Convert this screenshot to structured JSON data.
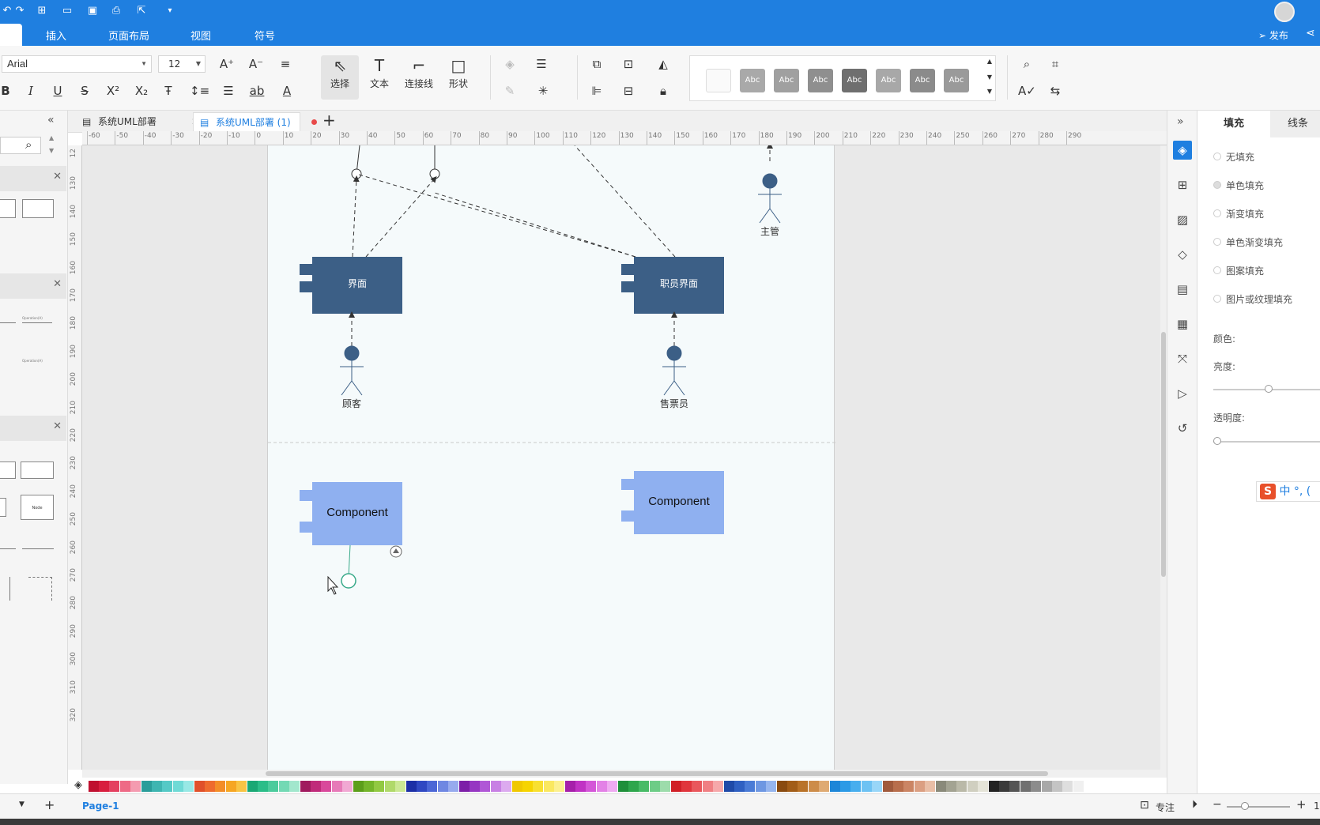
{
  "menu": {
    "items": [
      "插入",
      "页面布局",
      "视图",
      "符号"
    ],
    "publish": "发布"
  },
  "toolbar": {
    "font": "Arial",
    "size": "12",
    "tools": [
      "选择",
      "文本",
      "连接线",
      "形状"
    ],
    "style_sample": "Abc"
  },
  "tabs": [
    {
      "label": "系统UML部署"
    },
    {
      "label": "系统UML部署 (1)"
    }
  ],
  "ruler": {
    "h_ticks": [
      "-60",
      "-50",
      "-40",
      "-30",
      "-20",
      "-10",
      "0",
      "10",
      "20",
      "30",
      "40",
      "50",
      "60",
      "70",
      "80",
      "90",
      "100",
      "110",
      "120",
      "130",
      "140",
      "150",
      "160",
      "170",
      "180",
      "190",
      "200",
      "210",
      "220",
      "230",
      "240",
      "250",
      "260",
      "270",
      "280",
      "290"
    ],
    "v_ticks": [
      "12",
      "130",
      "140",
      "150",
      "160",
      "170",
      "180",
      "190",
      "200",
      "210",
      "220",
      "230",
      "240",
      "250",
      "260",
      "270",
      "280",
      "290",
      "300",
      "310",
      "320"
    ]
  },
  "diagram": {
    "components": [
      "界面",
      "职员界面",
      "Component",
      "Component"
    ],
    "actors": [
      "主管",
      "顾客",
      "售票员"
    ]
  },
  "right_panel": {
    "tabs": [
      "填充",
      "线条"
    ],
    "fill_options": [
      "无填充",
      "单色填充",
      "渐变填充",
      "单色渐变填充",
      "图案填充",
      "图片或纹理填充"
    ],
    "labels": {
      "color": "颜色:",
      "brightness": "亮度:",
      "transparency": "透明度:"
    },
    "ime": "中 °, ("
  },
  "status": {
    "page": "Page-1",
    "focus": "专注",
    "zoom_prefix": "1"
  },
  "left_panel": {
    "sample_texts": [
      "Operation(A)",
      "Operation(A)",
      "Node"
    ]
  },
  "colors": {
    "accent": "#1f7fe0",
    "component_dark": "#3c5f86",
    "component_light": "#8fb0f0",
    "actor": "#3c5f86"
  }
}
